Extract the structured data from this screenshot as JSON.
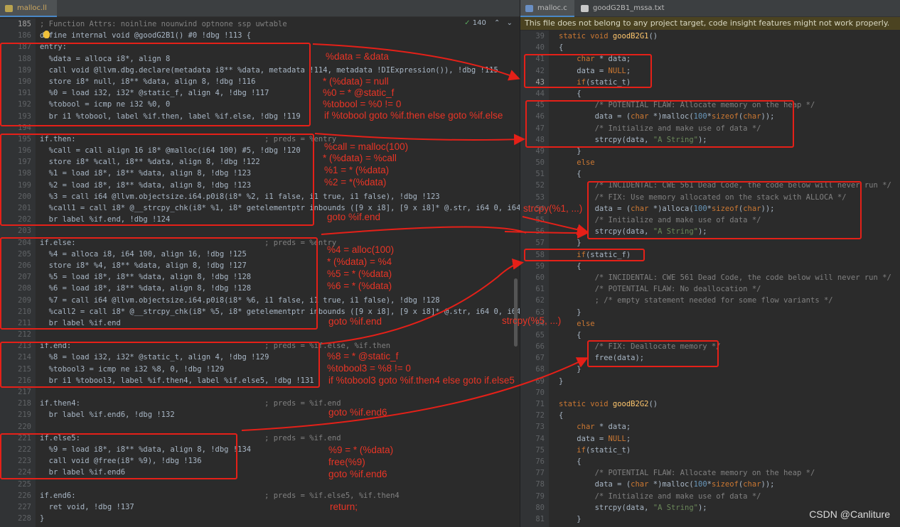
{
  "left_tab": {
    "label": "malloc.ll",
    "close": "×"
  },
  "right_tabs": [
    {
      "label": "malloc.c"
    },
    {
      "label": "goodG2B1_mssa.txt"
    }
  ],
  "inspection_count": "140",
  "banner": "This file does not belong to any project target, code insight features might not work properly.",
  "watermark": "CSDN @Canliture",
  "left_line_numbers": [
    "185",
    "186",
    "187",
    "188",
    "189",
    "190",
    "191",
    "192",
    "193",
    "194",
    "195",
    "196",
    "197",
    "198",
    "199",
    "200",
    "201",
    "202",
    "203",
    "204",
    "205",
    "206",
    "207",
    "208",
    "209",
    "210",
    "211",
    "212",
    "213",
    "214",
    "215",
    "216",
    "217",
    "218",
    "219",
    "220",
    "221",
    "222",
    "223",
    "224",
    "225",
    "226",
    "227",
    "228"
  ],
  "left_code": [
    "; Function Attrs: noinline nounwind optnone ssp uwtable",
    "define internal void @goodG2B1() #0 !dbg !113 {",
    "entry:",
    "  %data = alloca i8*, align 8",
    "  call void @llvm.dbg.declare(metadata i8** %data, metadata !114, metadata !DIExpression()), !dbg !115",
    "  store i8* null, i8** %data, align 8, !dbg !116",
    "  %0 = load i32, i32* @static_f, align 4, !dbg !117",
    "  %tobool = icmp ne i32 %0, 0",
    "  br i1 %tobool, label %if.then, label %if.else, !dbg !119",
    "",
    "if.then:                                          ; preds = %entry",
    "  %call = call align 16 i8* @malloc(i64 100) #5, !dbg !120",
    "  store i8* %call, i8** %data, align 8, !dbg !122",
    "  %1 = load i8*, i8** %data, align 8, !dbg !123",
    "  %2 = load i8*, i8** %data, align 8, !dbg !123",
    "  %3 = call i64 @llvm.objectsize.i64.p0i8(i8* %2, i1 false, i1 true, i1 false), !dbg !123",
    "  %call1 = call i8* @__strcpy_chk(i8* %1, i8* getelementptr inbounds ([9 x i8], [9 x i8]* @.str, i64 0, i64 0), i64 %3)",
    "  br label %if.end, !dbg !124",
    "",
    "if.else:                                          ; preds = %entry",
    "  %4 = alloca i8, i64 100, align 16, !dbg !125",
    "  store i8* %4, i8** %data, align 8, !dbg !127",
    "  %5 = load i8*, i8** %data, align 8, !dbg !128",
    "  %6 = load i8*, i8** %data, align 8, !dbg !128",
    "  %7 = call i64 @llvm.objectsize.i64.p0i8(i8* %6, i1 false, i1 true, i1 false), !dbg !128",
    "  %call2 = call i8* @__strcpy_chk(i8* %5, i8* getelementptr inbounds ([9 x i8], [9 x i8]* @.str, i64 0, i64 0), i64 %7)",
    "  br label %if.end",
    "",
    "if.end:                                           ; preds = %if.else, %if.then",
    "  %8 = load i32, i32* @static_t, align 4, !dbg !129",
    "  %tobool3 = icmp ne i32 %8, 0, !dbg !129",
    "  br i1 %tobool3, label %if.then4, label %if.else5, !dbg !131",
    "",
    "if.then4:                                         ; preds = %if.end",
    "  br label %if.end6, !dbg !132",
    "",
    "if.else5:                                         ; preds = %if.end",
    "  %9 = load i8*, i8** %data, align 8, !dbg !134",
    "  call void @free(i8* %9), !dbg !136",
    "  br label %if.end6",
    "",
    "if.end6:                                          ; preds = %if.else5, %if.then4",
    "  ret void, !dbg !137",
    "}"
  ],
  "right_line_numbers": [
    "39",
    "40",
    "41",
    "42",
    "43",
    "44",
    "45",
    "46",
    "47",
    "48",
    "49",
    "50",
    "51",
    "52",
    "53",
    "54",
    "55",
    "56",
    "57",
    "58",
    "59",
    "60",
    "61",
    "62",
    "63",
    "64",
    "65",
    "66",
    "67",
    "68",
    "69",
    "70",
    "71",
    "72",
    "73",
    "74",
    "75",
    "76",
    "77",
    "78",
    "79",
    "80",
    "81"
  ],
  "right_code": [
    "static void goodB2G1()",
    "{",
    "    char * data;",
    "    data = NULL;",
    "    if(static_t)",
    "    {",
    "        /* POTENTIAL FLAW: Allocate memory on the heap */",
    "        data = (char *)malloc(100*sizeof(char));",
    "        /* Initialize and make use of data */",
    "        strcpy(data, \"A String\");",
    "    }",
    "    else",
    "    {",
    "        /* INCIDENTAL: CWE 561 Dead Code, the code below will never run */",
    "        /* FIX: Use memory allocated on the stack with ALLOCA */",
    "        data = (char *)alloca(100*sizeof(char));",
    "        /* Initialize and make use of data */",
    "        strcpy(data, \"A String\");",
    "    }",
    "    if(static_f)",
    "    {",
    "        /* INCIDENTAL: CWE 561 Dead Code, the code below will never run */",
    "        /* POTENTIAL FLAW: No deallocation */",
    "        ; /* empty statement needed for some flow variants */",
    "    }",
    "    else",
    "    {",
    "        /* FIX: Deallocate memory */",
    "        free(data);",
    "    }",
    "}",
    "",
    "static void goodB2G2()",
    "{",
    "    char * data;",
    "    data = NULL;",
    "    if(static_t)",
    "    {",
    "        /* POTENTIAL FLAW: Allocate memory on the heap */",
    "        data = (char *)malloc(100*sizeof(char));",
    "        /* Initialize and make use of data */",
    "        strcpy(data, \"A String\");",
    "    }"
  ],
  "annotations": [
    "%data = &data",
    "* (%data) = null",
    "%0 = * @static_f",
    "%tobool = %0 != 0",
    "if %tobool goto %if.then else goto %if.else",
    "%call = malloc(100)",
    "* (%data) = %call",
    "%1 = * (%data)",
    "%2 = *(%data)",
    "strcpy(%1, ...)",
    "goto %if.end",
    "%4 = alloc(100)",
    "* (%data) = %4",
    "%5 = * (%data)",
    "%6 = * (%data)",
    "goto %if.end",
    "strcpy(%5, ...)",
    "%8 = * @static_f",
    "%tobool3 = %8 != 0",
    "if %tobool3 goto %if.then4 else goto if.else5",
    "goto %if.end6",
    "%9 = * (%data)",
    "free(%9)",
    "goto %if.end6",
    "return;"
  ]
}
